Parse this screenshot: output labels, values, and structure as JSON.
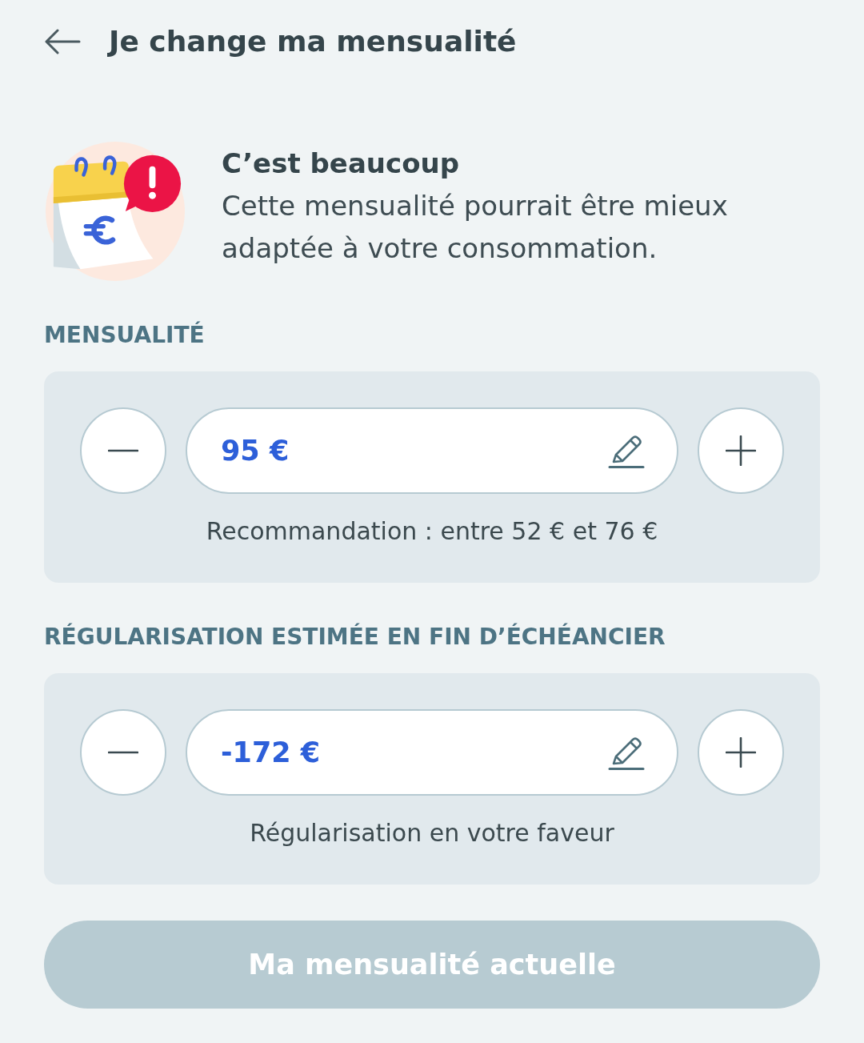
{
  "header": {
    "title": "Je change ma mensualité"
  },
  "alert": {
    "title": "C’est beaucoup",
    "message": "Cette mensualité pourrait être mieux adaptée à votre consommation."
  },
  "sections": [
    {
      "label": "MENSUALITÉ",
      "value": "95 €",
      "note": "Recommandation : entre 52 € et 76 €"
    },
    {
      "label": "RÉGULARISATION ESTIMÉE EN FIN D’ÉCHÉANCIER",
      "value": "-172 €",
      "note": "Régularisation en votre faveur"
    }
  ],
  "button": {
    "label": "Ma mensualité actuelle",
    "disabled": true
  }
}
